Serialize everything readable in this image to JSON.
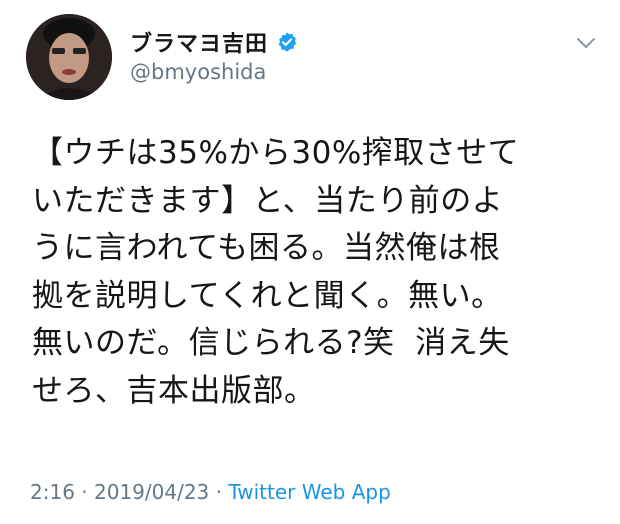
{
  "author": {
    "display_name": "ブラマヨ吉田",
    "handle": "@bmyoshida",
    "verified": true,
    "brand_color": "#1da1f2"
  },
  "menu_icon": "chevron-down-icon",
  "tweet": {
    "text": "【ウチは35%から30%搾取させて\nいただきます】と、当たり前のよ\nうに言われても困る。当然俺は根\n拠を説明してくれと聞く。無い。\n無いのだ。信じられる?笑  消え失\nせろ、吉本出版部。"
  },
  "meta": {
    "time": "2:16",
    "separator": " · ",
    "date": "2019/04/23",
    "source": "Twitter Web App"
  },
  "colors": {
    "text": "#14171a",
    "secondary": "#657786",
    "link": "#1b95e0"
  }
}
